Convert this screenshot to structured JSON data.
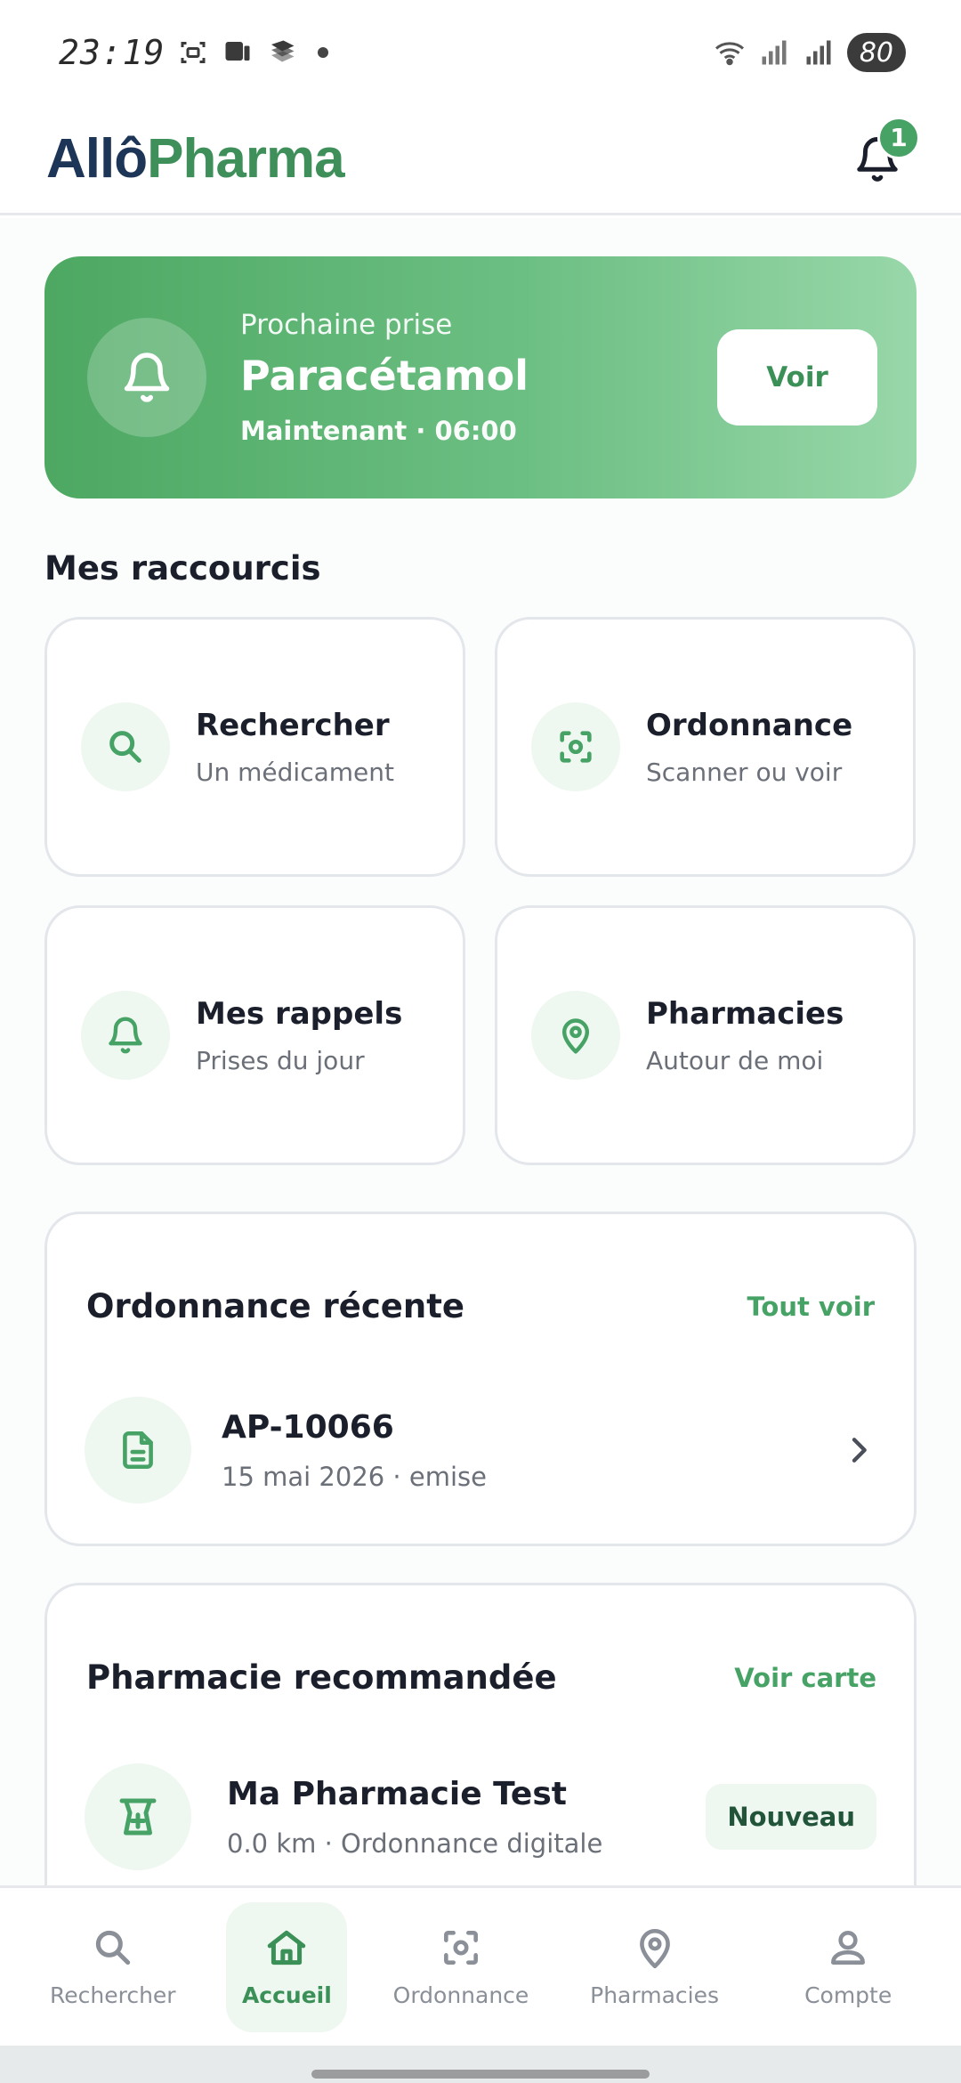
{
  "status_bar": {
    "time": "23:19",
    "battery": "80",
    "icons": [
      "screenshot-icon",
      "gallery-icon",
      "device-icon",
      "stack-icon",
      "wifi-icon",
      "signal-icon",
      "signal-icon"
    ]
  },
  "header": {
    "logo_part1": "Allô",
    "logo_part2": "Pharma",
    "notification_count": "1"
  },
  "hero": {
    "label": "Prochaine prise",
    "medication": "Paracétamol",
    "time_info": "Maintenant · 06:00",
    "button": "Voir"
  },
  "shortcuts": {
    "title": "Mes raccourcis",
    "items": [
      {
        "title": "Rechercher",
        "subtitle": "Un médicament",
        "icon": "search-icon"
      },
      {
        "title": "Ordonnance",
        "subtitle": "Scanner ou voir",
        "icon": "scan-icon"
      },
      {
        "title": "Mes rappels",
        "subtitle": "Prises du jour",
        "icon": "bell-icon"
      },
      {
        "title": "Pharmacies",
        "subtitle": "Autour de moi",
        "icon": "location-pin-icon"
      }
    ]
  },
  "recent_prescription": {
    "title": "Ordonnance récente",
    "link": "Tout voir",
    "id": "AP-10066",
    "details": "15 mai 2026 · emise"
  },
  "recommended_pharmacy": {
    "title": "Pharmacie recommandée",
    "link": "Voir carte",
    "name": "Ma Pharmacie Test",
    "details": "0.0 km · Ordonnance digitale",
    "badge": "Nouveau"
  },
  "bottom_nav": {
    "items": [
      {
        "label": "Rechercher",
        "icon": "search-icon"
      },
      {
        "label": "Accueil",
        "icon": "home-icon",
        "active": true
      },
      {
        "label": "Ordonnance",
        "icon": "scan-icon"
      },
      {
        "label": "Pharmacies",
        "icon": "location-pin-icon"
      },
      {
        "label": "Compte",
        "icon": "user-icon"
      }
    ]
  },
  "colors": {
    "primary": "#47a266",
    "logo_dark": "#1d3557",
    "logo_green": "#3e8f5a",
    "icon_bg": "#eef7f0"
  }
}
